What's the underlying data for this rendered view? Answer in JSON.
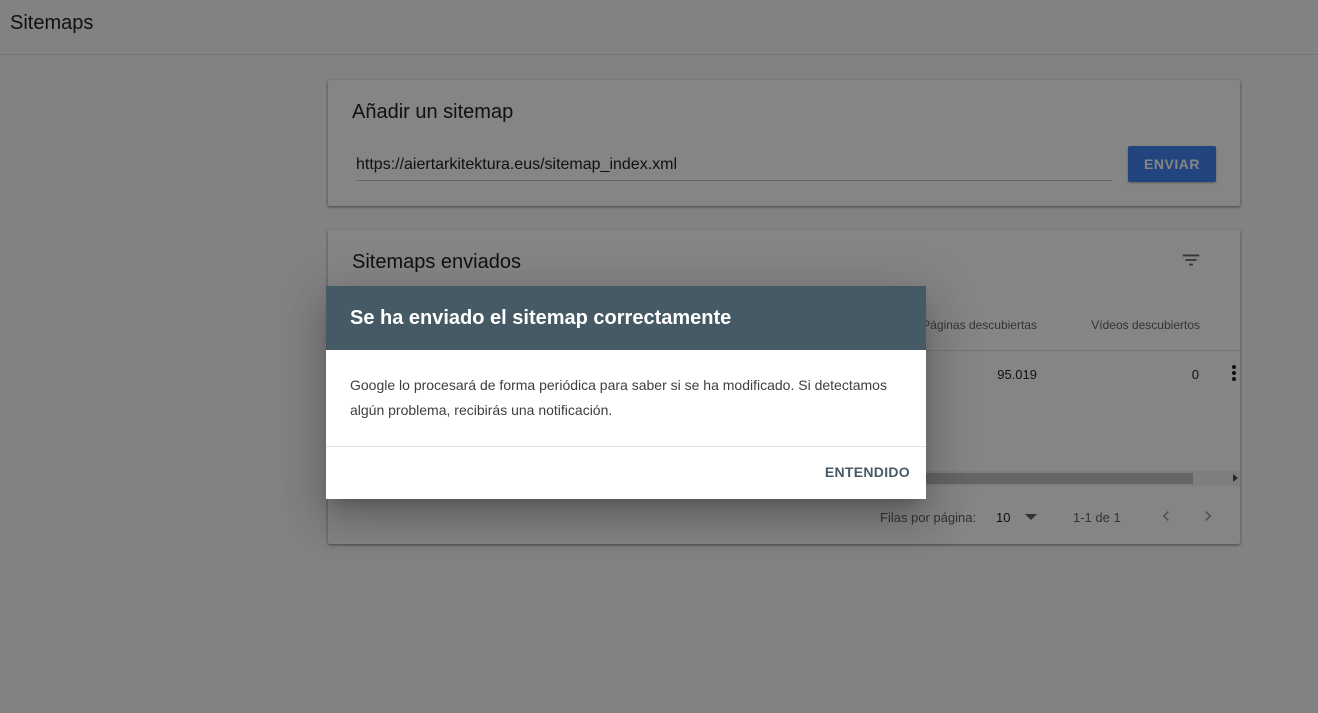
{
  "page": {
    "title": "Sitemaps"
  },
  "add_card": {
    "title": "Añadir un sitemap",
    "url_value": "https://aiertarkitektura.eus/sitemap_index.xml",
    "submit_label": "ENVIAR"
  },
  "list_card": {
    "title": "Sitemaps enviados",
    "filter_icon": "filter-list-icon",
    "columns": [
      "Páginas descubiertas",
      "Vídeos descubiertos"
    ],
    "rows": [
      {
        "pages_discovered": "95.019",
        "videos_discovered": "0"
      }
    ],
    "more_icon": "more-vert-icon",
    "pagination": {
      "rows_per_page_label": "Filas por página:",
      "rows_per_page_value": "10",
      "range": "1-1 de 1"
    }
  },
  "dialog": {
    "title": "Se ha enviado el sitemap correctamente",
    "body": "Google lo procesará de forma periódica para saber si se ha modificado. Si detectamos algún problema, recibirás una notificación.",
    "ok_label": "ENTENDIDO"
  },
  "colors": {
    "accent": "#4285f4",
    "dialog_header": "#455a64",
    "scrim": "rgba(0,0,0,0.48)"
  }
}
